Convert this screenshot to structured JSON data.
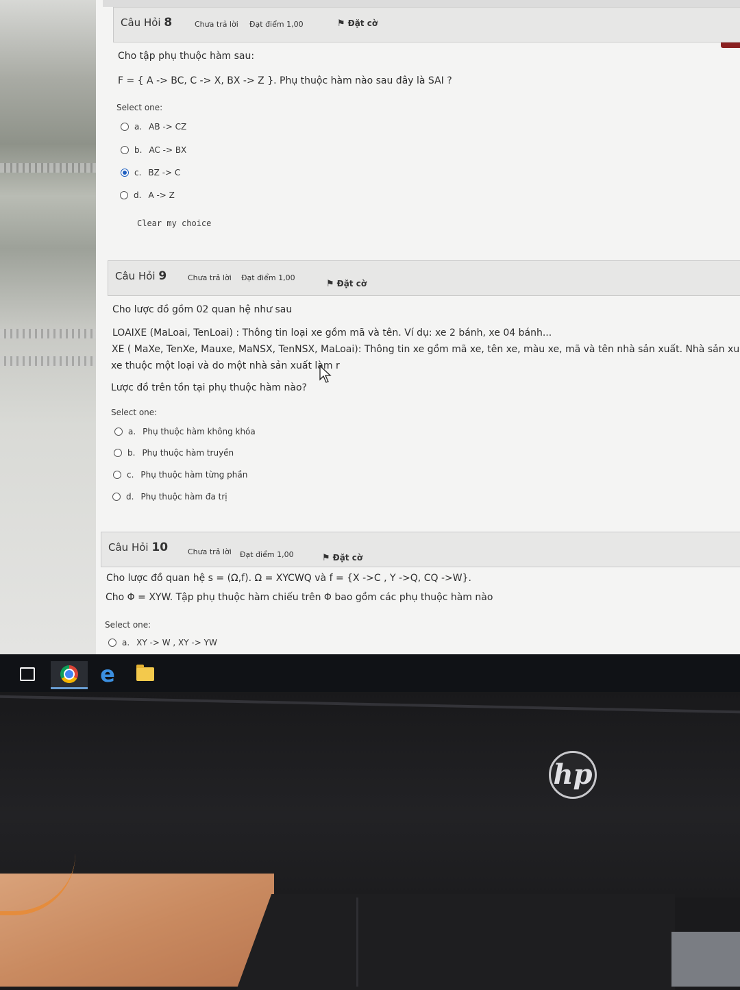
{
  "q8": {
    "label": "Câu Hỏi",
    "number": "8",
    "state": "Chưa trả lời",
    "grade": "Đạt điểm 1,00",
    "flag": "Đặt cờ",
    "text1": "Cho tập phụ thuộc hàm sau:",
    "text2": "F = { A -> BC, C -> X, BX -> Z }. Phụ thuộc hàm nào sau đây là SAI ?",
    "select_one": "Select one:",
    "options": [
      {
        "letter": "a.",
        "text": "AB -> CZ",
        "selected": false
      },
      {
        "letter": "b.",
        "text": "AC -> BX",
        "selected": false
      },
      {
        "letter": "c.",
        "text": "BZ -> C",
        "selected": true
      },
      {
        "letter": "d.",
        "text": "A -> Z",
        "selected": false
      }
    ],
    "clear": "Clear my choice"
  },
  "q9": {
    "label": "Câu Hỏi",
    "number": "9",
    "state": "Chưa trả lời",
    "grade": "Đạt điểm 1,00",
    "flag": "Đặt cờ",
    "text1": "Cho lược đồ gồm 02 quan hệ như sau",
    "text2": "LOAIXE (MaLoai, TenLoai) : Thông tin loại xe gồm mã và tên. Ví dụ: xe 2 bánh, xe 04 bánh...",
    "text3": "XE ( MaXe, TenXe, Mauxe, MaNSX, TenNSX, MaLoai): Thông tin xe gồm mã xe, tên xe, màu xe, mã và tên nhà sản xuất. Nhà sản xuất, ví dụ, H",
    "text4": "xe thuộc một loại và do một nhà sản xuất làm r",
    "text5": "Lược đồ trên tồn tại phụ thuộc hàm nào?",
    "select_one": "Select one:",
    "options": [
      {
        "letter": "a.",
        "text": "Phụ thuộc hàm không khóa",
        "selected": false
      },
      {
        "letter": "b.",
        "text": "Phụ thuộc hàm truyền",
        "selected": false
      },
      {
        "letter": "c.",
        "text": "Phụ thuộc hàm từng phần",
        "selected": false
      },
      {
        "letter": "d.",
        "text": "Phụ thuộc hàm đa trị",
        "selected": false
      }
    ]
  },
  "q10": {
    "label": "Câu Hỏi",
    "number": "10",
    "state": "Chưa trả lời",
    "grade": "Đạt điểm 1,00",
    "flag": "Đặt cờ",
    "text1": "Cho lược đồ quan hệ s = (Ω,f). Ω = XYCWQ và f = {X ->C , Y ->Q, CQ ->W}.",
    "text2": "Cho Φ = XYW. Tập phụ thuộc hàm chiếu trên Φ bao gồm các phụ thuộc hàm nào",
    "select_one": "Select one:",
    "options": [
      {
        "letter": "a.",
        "text": "XY -> W , XY -> YW",
        "selected": false
      }
    ]
  },
  "taskbar": {
    "icons": [
      "task-view-icon",
      "chrome-icon",
      "edge-icon",
      "file-explorer-icon"
    ]
  },
  "monitor": {
    "brand": "hp"
  },
  "colors": {
    "radio_selected": "#1f5fbf",
    "nav_button": "#8a2020",
    "taskbar": "#101216"
  }
}
